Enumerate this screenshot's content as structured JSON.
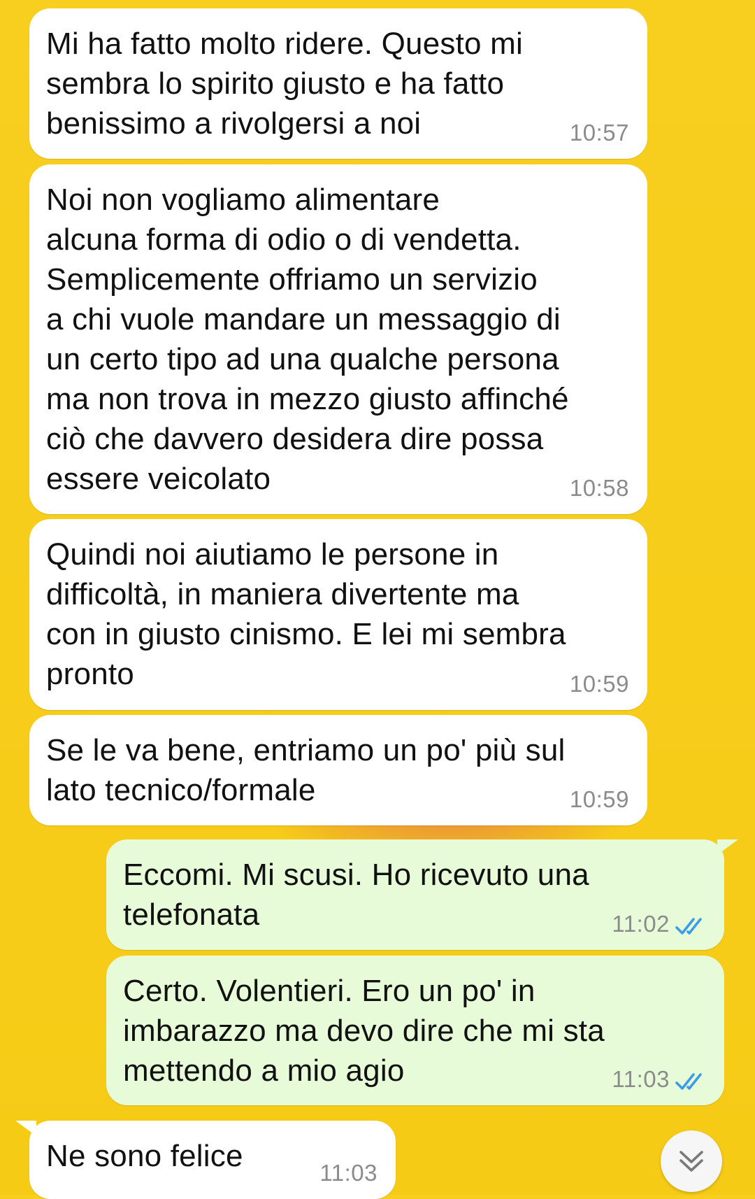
{
  "background": {
    "color": "#f7cf1c"
  },
  "messages": [
    {
      "direction": "incoming",
      "text": "Mi ha fatto molto ridere. Questo mi\nsembra lo spirito giusto e ha fatto\nbenissimo a rivolgersi a noi",
      "time": "10:57"
    },
    {
      "direction": "incoming",
      "text": "Noi non vogliamo alimentare\nalcuna forma di odio o di vendetta.\nSemplicemente offriamo un servizio\na chi vuole mandare un messaggio di\nun certo tipo ad una qualche persona\nma non trova in mezzo giusto affinché\nciò che davvero desidera dire possa\nessere veicolato",
      "time": "10:58"
    },
    {
      "direction": "incoming",
      "text": "Quindi noi aiutiamo le persone in\ndifficoltà, in maniera divertente ma\ncon in giusto cinismo. E lei mi sembra\npronto",
      "time": "10:59"
    },
    {
      "direction": "incoming",
      "text": "Se le va bene, entriamo un po' più sul\nlato tecnico/formale",
      "time": "10:59"
    },
    {
      "direction": "outgoing",
      "text": "Eccomi. Mi scusi. Ho ricevuto una\ntelefonata",
      "time": "11:02",
      "status": "read"
    },
    {
      "direction": "outgoing",
      "text": "Certo. Volentieri. Ero un po' in\nimbarazzo ma devo dire che mi sta\nmettendo a mio agio",
      "time": "11:03",
      "status": "read"
    },
    {
      "direction": "incoming",
      "text": "Ne sono felice",
      "time": "11:03"
    }
  ],
  "icons": {
    "read_receipt": "double-check-icon",
    "scroll_down": "double-chevron-down-icon"
  },
  "colors": {
    "incoming_bubble": "#ffffff",
    "outgoing_bubble": "#e7fbd9",
    "read_tick": "#3a9de6",
    "timestamp": "#8b8b8b"
  }
}
